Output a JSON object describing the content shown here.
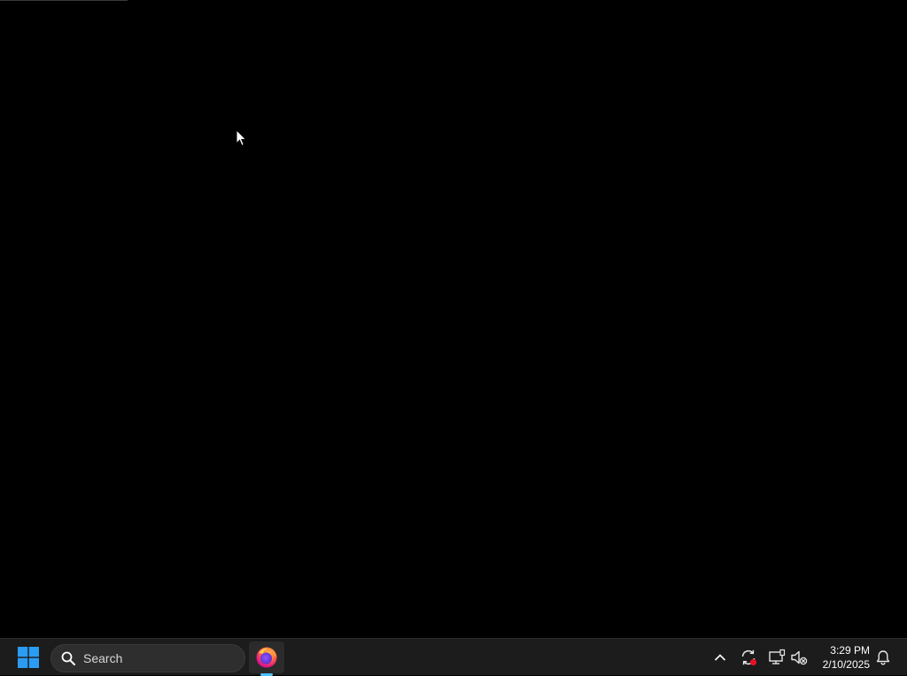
{
  "desktop": {
    "background_color": "#000000"
  },
  "taskbar": {
    "background_color": "#1c1c1c",
    "start": {
      "icon": "windows-logo-icon",
      "accent_color": "#2b9cf2"
    },
    "search": {
      "label": "Search",
      "icon": "search-icon"
    },
    "pinned_apps": [
      {
        "name": "Firefox",
        "icon": "firefox-icon",
        "running": true,
        "indicator_color": "#4cc2ff"
      }
    ],
    "tray": {
      "icons": [
        "chevron-up-icon",
        "sync-alert-icon",
        "network-icon",
        "volume-muted-icon"
      ],
      "alert_color": "#e81123",
      "clock": {
        "time": "3:29 PM",
        "date": "2/10/2025"
      },
      "notification_icon": "bell-icon"
    }
  }
}
